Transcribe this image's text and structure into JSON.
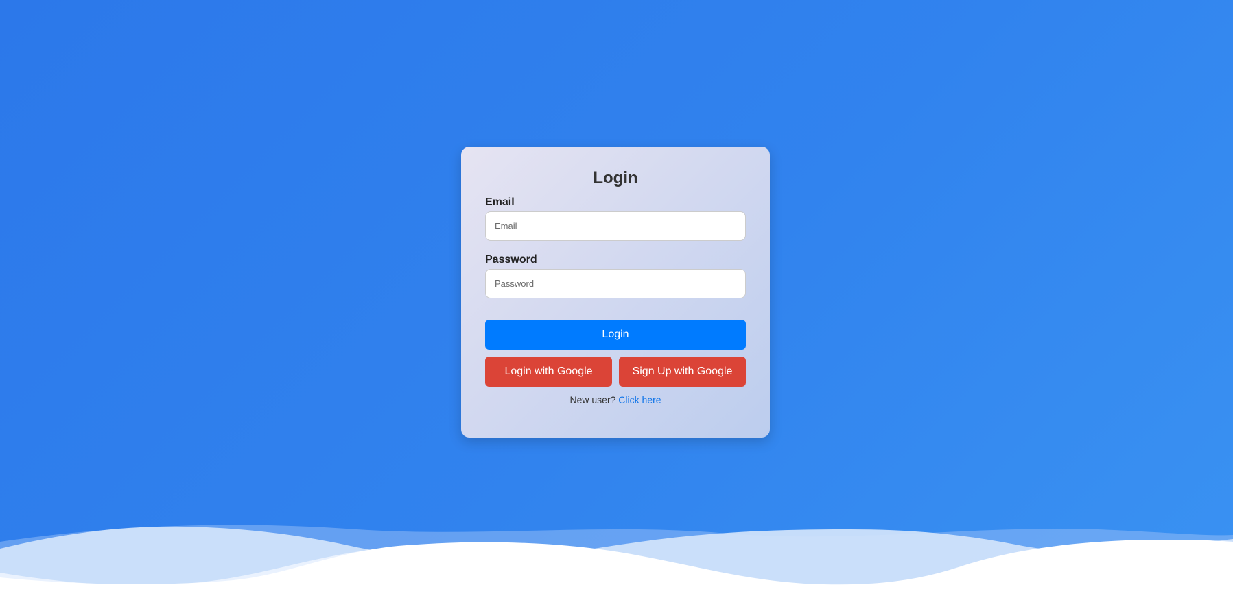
{
  "login_form": {
    "title": "Login",
    "email": {
      "label": "Email",
      "placeholder": "Email",
      "value": ""
    },
    "password": {
      "label": "Password",
      "placeholder": "Password",
      "value": ""
    },
    "login_button": "Login",
    "login_google_button": "Login with Google",
    "signup_google_button": "Sign Up with Google",
    "new_user_text": "New user?",
    "click_here_link": "Click here"
  },
  "colors": {
    "background": "#2f7deb",
    "primary_button": "#007bff",
    "google_button": "#db4437",
    "link": "#0d73e8"
  }
}
